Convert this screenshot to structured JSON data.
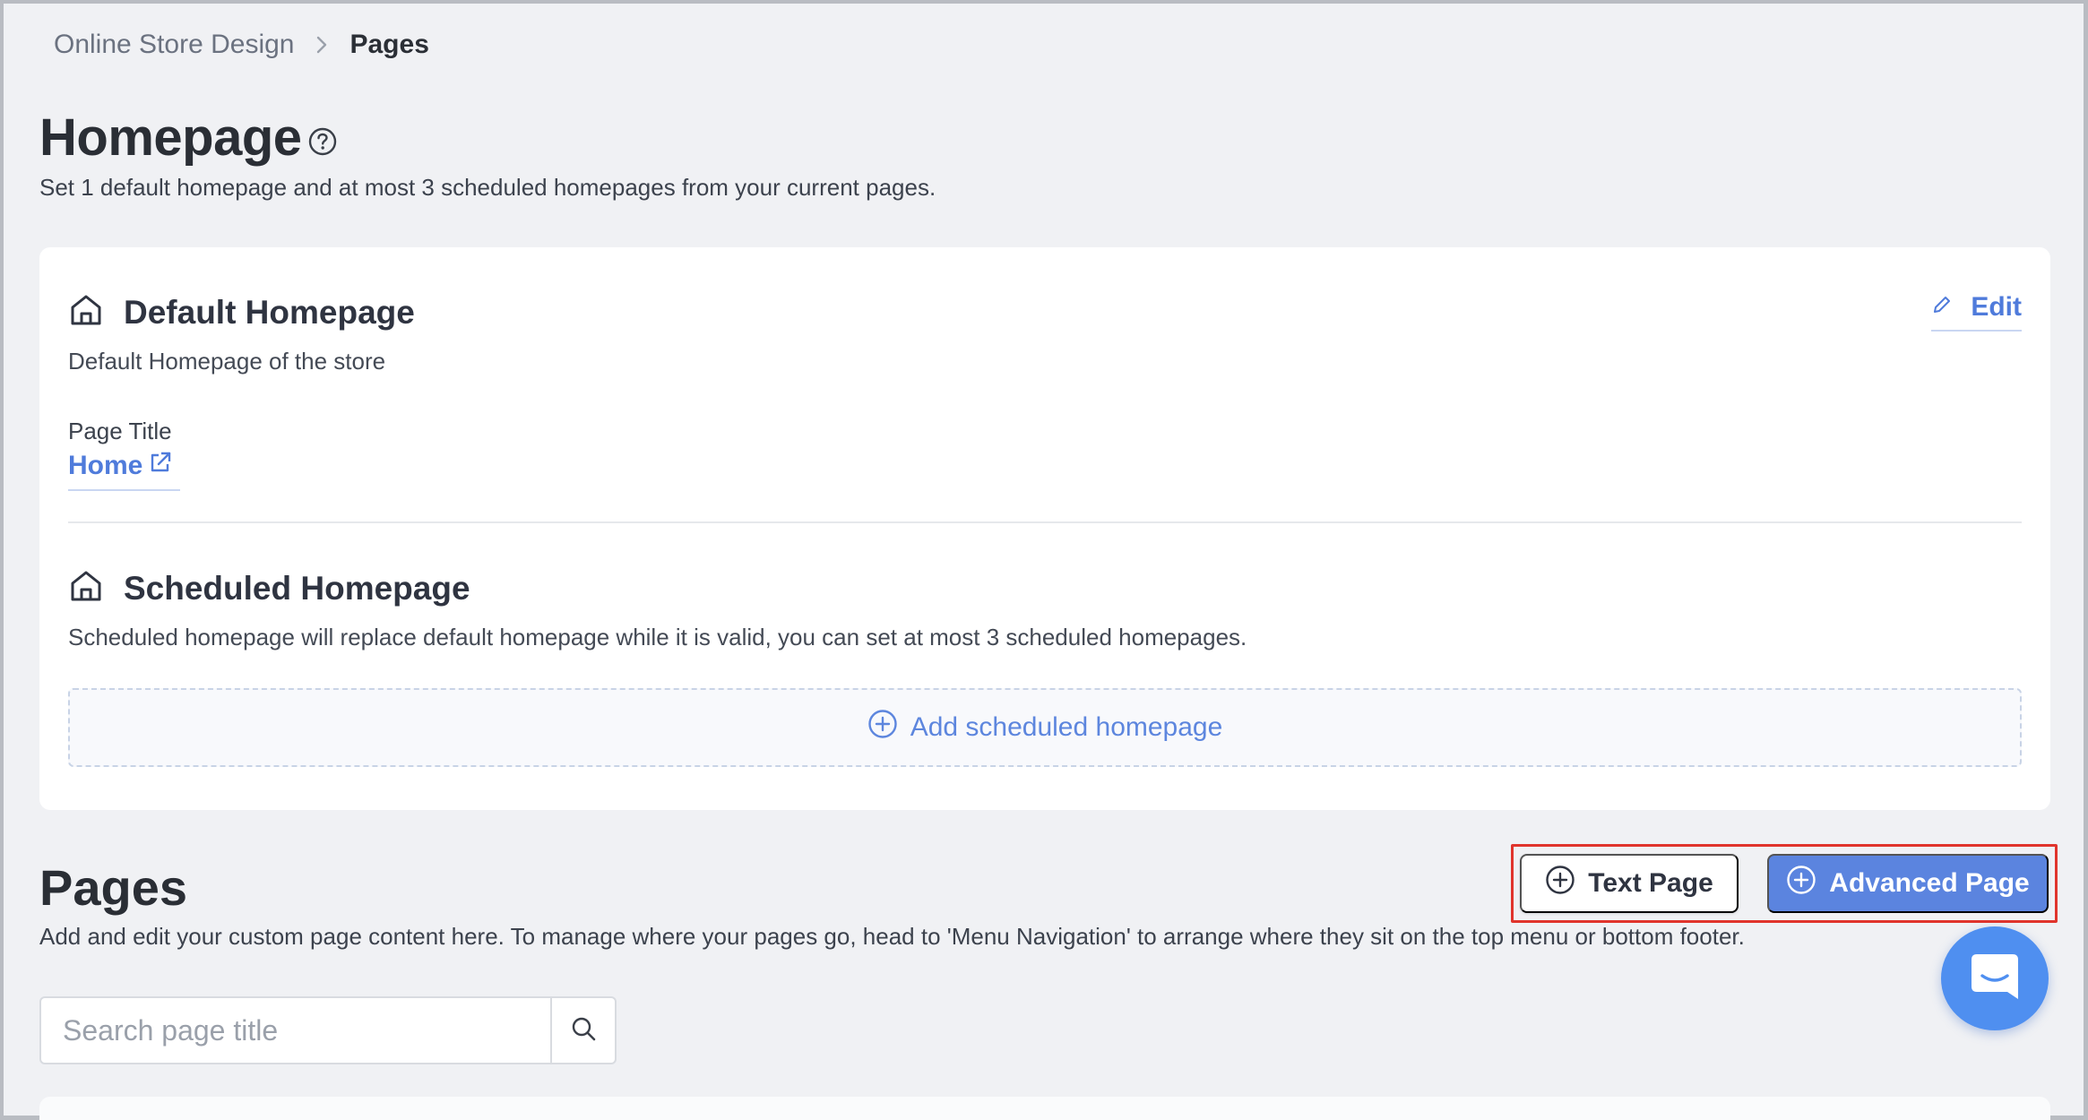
{
  "breadcrumb": {
    "parent": "Online Store Design",
    "current": "Pages"
  },
  "homepage": {
    "title": "Homepage",
    "subtitle": "Set 1 default homepage and at most 3 scheduled homepages from your current pages."
  },
  "default_homepage": {
    "title": "Default Homepage",
    "description": "Default Homepage of the store",
    "edit_label": "Edit",
    "field_label": "Page Title",
    "page_link": "Home"
  },
  "scheduled_homepage": {
    "title": "Scheduled Homepage",
    "description": "Scheduled homepage will replace default homepage while it is valid, you can set at most 3 scheduled homepages.",
    "add_label": "Add scheduled homepage"
  },
  "pages": {
    "title": "Pages",
    "description": "Add and edit your custom page content here. To manage where your pages go, head to 'Menu Navigation' to arrange where they sit on the top menu or bottom footer.",
    "text_page_label": "Text Page",
    "advanced_page_label": "Advanced Page",
    "search_placeholder": "Search page title"
  },
  "colors": {
    "accent": "#5b84df",
    "link": "#4f7bdb",
    "highlight": "#e0342c",
    "chat": "#4f8ff0"
  }
}
